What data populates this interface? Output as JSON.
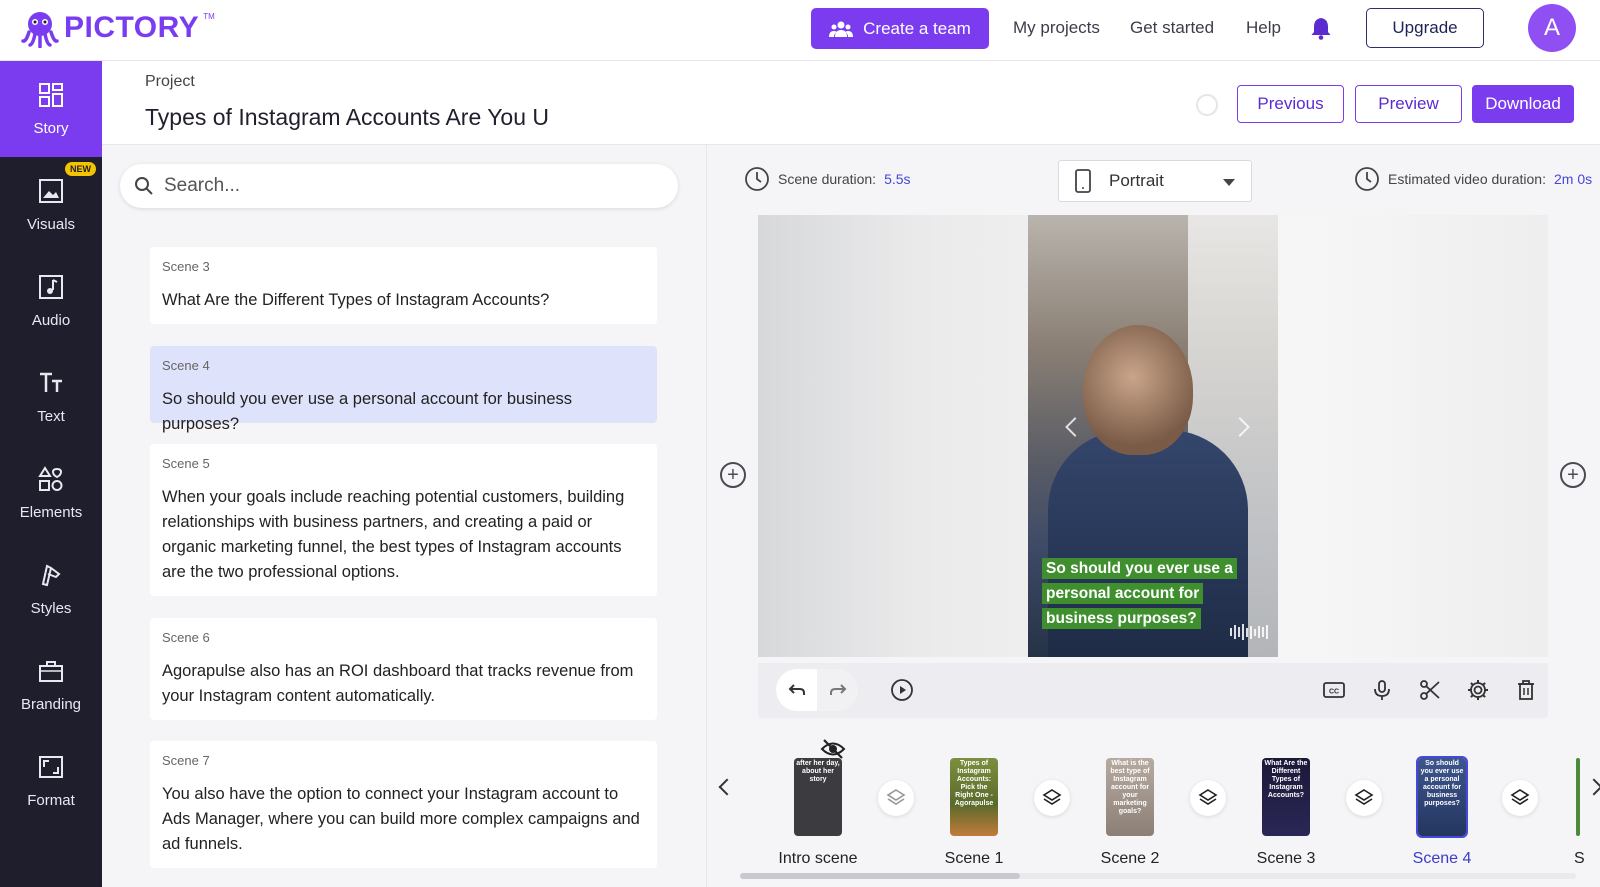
{
  "app": {
    "name": "PICTORY",
    "tm": "TM"
  },
  "topnav": {
    "create_team": "Create a team",
    "links": [
      "My projects",
      "Get started",
      "Help"
    ],
    "upgrade": "Upgrade",
    "avatar_initial": "A"
  },
  "sidebar": {
    "items": [
      {
        "label": "Story",
        "icon": "grid-icon",
        "active": true
      },
      {
        "label": "Visuals",
        "icon": "image-icon",
        "badge": "NEW"
      },
      {
        "label": "Audio",
        "icon": "music-note-icon"
      },
      {
        "label": "Text",
        "icon": "text-icon"
      },
      {
        "label": "Elements",
        "icon": "shapes-icon"
      },
      {
        "label": "Styles",
        "icon": "brush-icon"
      },
      {
        "label": "Branding",
        "icon": "briefcase-icon"
      },
      {
        "label": "Format",
        "icon": "aspect-ratio-icon"
      }
    ]
  },
  "project": {
    "label": "Project",
    "title": "Types of Instagram Accounts Are You U",
    "buttons": {
      "previous": "Previous",
      "preview": "Preview",
      "download": "Download"
    }
  },
  "search": {
    "placeholder": "Search..."
  },
  "scenes": [
    {
      "label": "Scene 3",
      "text": "What Are the Different Types of Instagram Accounts?"
    },
    {
      "label": "Scene 4",
      "text": "So should you ever use a personal account for business purposes?",
      "selected": true
    },
    {
      "label": "Scene 5",
      "text": "When your goals include reaching potential customers, building relationships with business partners, and creating a paid or organic marketing funnel, the best types of Instagram accounts are the two professional options."
    },
    {
      "label": "Scene 6",
      "text": "Agorapulse also has an ROI dashboard that tracks revenue from your Instagram content automatically."
    },
    {
      "label": "Scene 7",
      "text": "You also have the option to connect your Instagram account to Ads Manager, where you can build more complex campaigns and ad funnels."
    }
  ],
  "editor": {
    "scene_duration_label": "Scene duration:",
    "scene_duration_value": "5.5s",
    "orientation": "Portrait",
    "estimated_label": "Estimated video duration:",
    "estimated_value": "2m 0s",
    "caption": "So should you ever use a personal account for business purposes?"
  },
  "timeline": {
    "items": [
      {
        "label": "Intro scene",
        "thumb_text": "after her day, about her story",
        "color": "#3b3b40"
      },
      {
        "label": "Scene 1",
        "thumb_text": "Types of Instagram Accounts: Pick the Right One - Agorapulse",
        "color": "#6f8a3c"
      },
      {
        "label": "Scene 2",
        "thumb_text": "What is the best type of Instagram account for your marketing goals?",
        "color": "#9a8c82"
      },
      {
        "label": "Scene 3",
        "thumb_text": "What Are the Different Types of Instagram Accounts?",
        "color": "#1d1a3a"
      },
      {
        "label": "Scene 4",
        "thumb_text": "So should you ever use a personal account for business purposes?",
        "color": "#3b4f8c",
        "selected": true
      },
      {
        "label": "S"
      }
    ]
  },
  "colors": {
    "brand": "#7b3cf0",
    "sidebar": "#1e1e2c",
    "accent_text": "#4747d8",
    "caption_bg": "#3f8f2f"
  }
}
